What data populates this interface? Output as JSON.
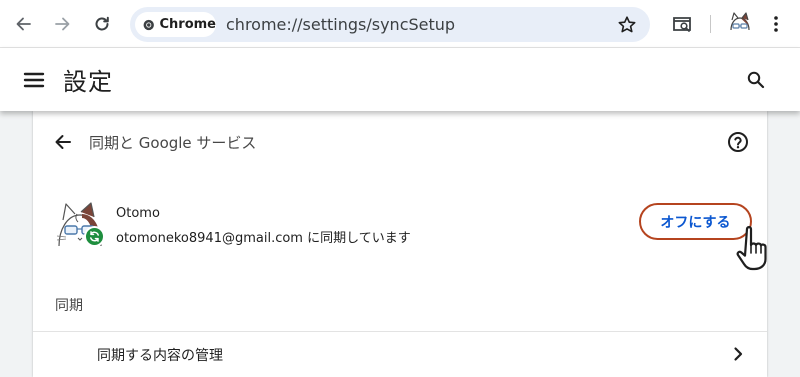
{
  "browser": {
    "chip_label": "Chrome",
    "url": "chrome://settings/syncSetup",
    "icons": [
      "back-icon",
      "forward-icon",
      "reload-icon",
      "chrome-logo-icon",
      "bookmark-star-icon",
      "search-tabs-icon",
      "profile-avatar-icon",
      "more-menu-icon"
    ]
  },
  "header": {
    "title": "設定",
    "icons": [
      "hamburger-menu-icon",
      "search-icon"
    ]
  },
  "page": {
    "title": "同期と Google サービス",
    "icons": [
      "back-arrow-icon",
      "help-icon"
    ]
  },
  "account": {
    "name": "Otomo",
    "status": "otomoneko8941@gmail.com に同期しています",
    "button_label": "オフにする",
    "sync_status_color": "#1e8e3e"
  },
  "sync_section": {
    "heading": "同期",
    "manage_label": "同期する内容の管理"
  },
  "colors": {
    "accent_blue": "#0b57d0",
    "highlight_ring": "#b5441f",
    "omnibox_bg": "#e8eef8",
    "page_bg": "#f1f3f4"
  }
}
